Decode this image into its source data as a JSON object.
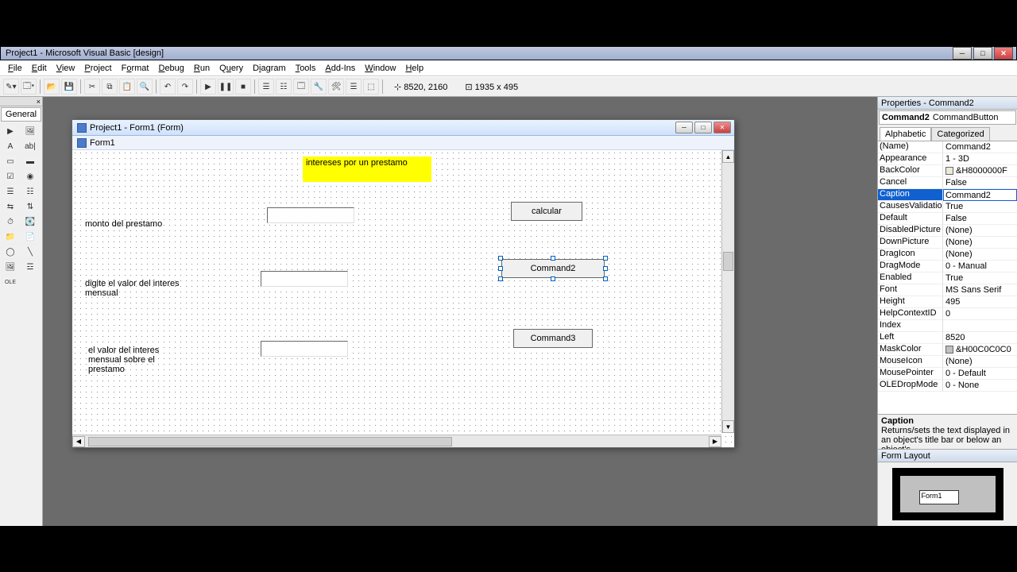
{
  "window_title": "Project1 - Microsoft Visual Basic [design]",
  "menu": [
    "File",
    "Edit",
    "View",
    "Project",
    "Format",
    "Debug",
    "Run",
    "Query",
    "Diagram",
    "Tools",
    "Add-Ins",
    "Window",
    "Help"
  ],
  "toolbar_coords": "8520, 2160",
  "toolbar_size": "1935 x 495",
  "toolbox_title": "General",
  "mdi_title": "Project1 - Form1 (Form)",
  "form_title": "Form1",
  "form": {
    "yellow_label": "intereses por un prestamo",
    "label1": "monto del prestamo",
    "label2": "digite  el valor del interes mensual",
    "label3": "el valor del interes mensual sobre el prestamo",
    "cmd1": "calcular",
    "cmd2": "Command2",
    "cmd3": "Command3"
  },
  "props_title": "Properties - Command2",
  "props_object_name": "Command2",
  "props_object_type": "CommandButton",
  "props_tabs": {
    "a": "Alphabetic",
    "b": "Categorized"
  },
  "properties": [
    {
      "n": "(Name)",
      "v": "Command2"
    },
    {
      "n": "Appearance",
      "v": "1 - 3D"
    },
    {
      "n": "BackColor",
      "v": "&H8000000F",
      "swatch": "#ece9d8"
    },
    {
      "n": "Cancel",
      "v": "False"
    },
    {
      "n": "Caption",
      "v": "Command2",
      "sel": true
    },
    {
      "n": "CausesValidation",
      "v": "True"
    },
    {
      "n": "Default",
      "v": "False"
    },
    {
      "n": "DisabledPicture",
      "v": "(None)"
    },
    {
      "n": "DownPicture",
      "v": "(None)"
    },
    {
      "n": "DragIcon",
      "v": "(None)"
    },
    {
      "n": "DragMode",
      "v": "0 - Manual"
    },
    {
      "n": "Enabled",
      "v": "True"
    },
    {
      "n": "Font",
      "v": "MS Sans Serif"
    },
    {
      "n": "Height",
      "v": "495"
    },
    {
      "n": "HelpContextID",
      "v": "0"
    },
    {
      "n": "Index",
      "v": ""
    },
    {
      "n": "Left",
      "v": "8520"
    },
    {
      "n": "MaskColor",
      "v": "&H00C0C0C0",
      "swatch": "#c0c0c0"
    },
    {
      "n": "MouseIcon",
      "v": "(None)"
    },
    {
      "n": "MousePointer",
      "v": "0 - Default"
    },
    {
      "n": "OLEDropMode",
      "v": "0 - None"
    }
  ],
  "help_title": "Caption",
  "help_text": "Returns/sets the text displayed in an object's title bar or below an object's",
  "form_layout_title": "Form Layout",
  "form_layout_form": "Form1"
}
